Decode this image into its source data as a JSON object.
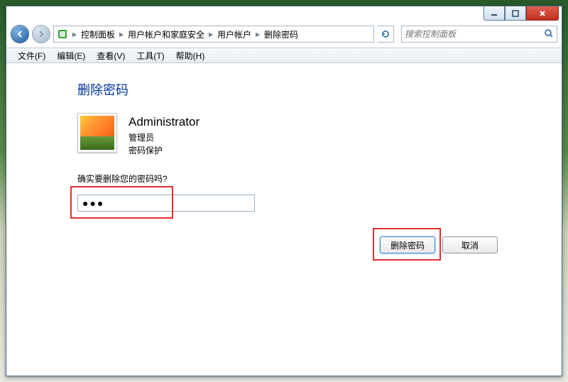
{
  "caption": {
    "minimize": "–",
    "maximize": "□",
    "close": "X"
  },
  "breadcrumb": {
    "items": [
      "控制面板",
      "用户帐户和家庭安全",
      "用户帐户",
      "删除密码"
    ]
  },
  "search": {
    "placeholder": "搜索控制面板"
  },
  "menu": {
    "file": "文件(F)",
    "edit": "编辑(E)",
    "view": "查看(V)",
    "tools": "工具(T)",
    "help": "帮助(H)"
  },
  "page": {
    "title": "删除密码",
    "user_name": "Administrator",
    "user_role": "管理员",
    "user_pw_status": "密码保护",
    "prompt": "确实要删除您的密码吗?",
    "password_value": "●●●"
  },
  "buttons": {
    "delete": "删除密码",
    "cancel": "取消"
  }
}
